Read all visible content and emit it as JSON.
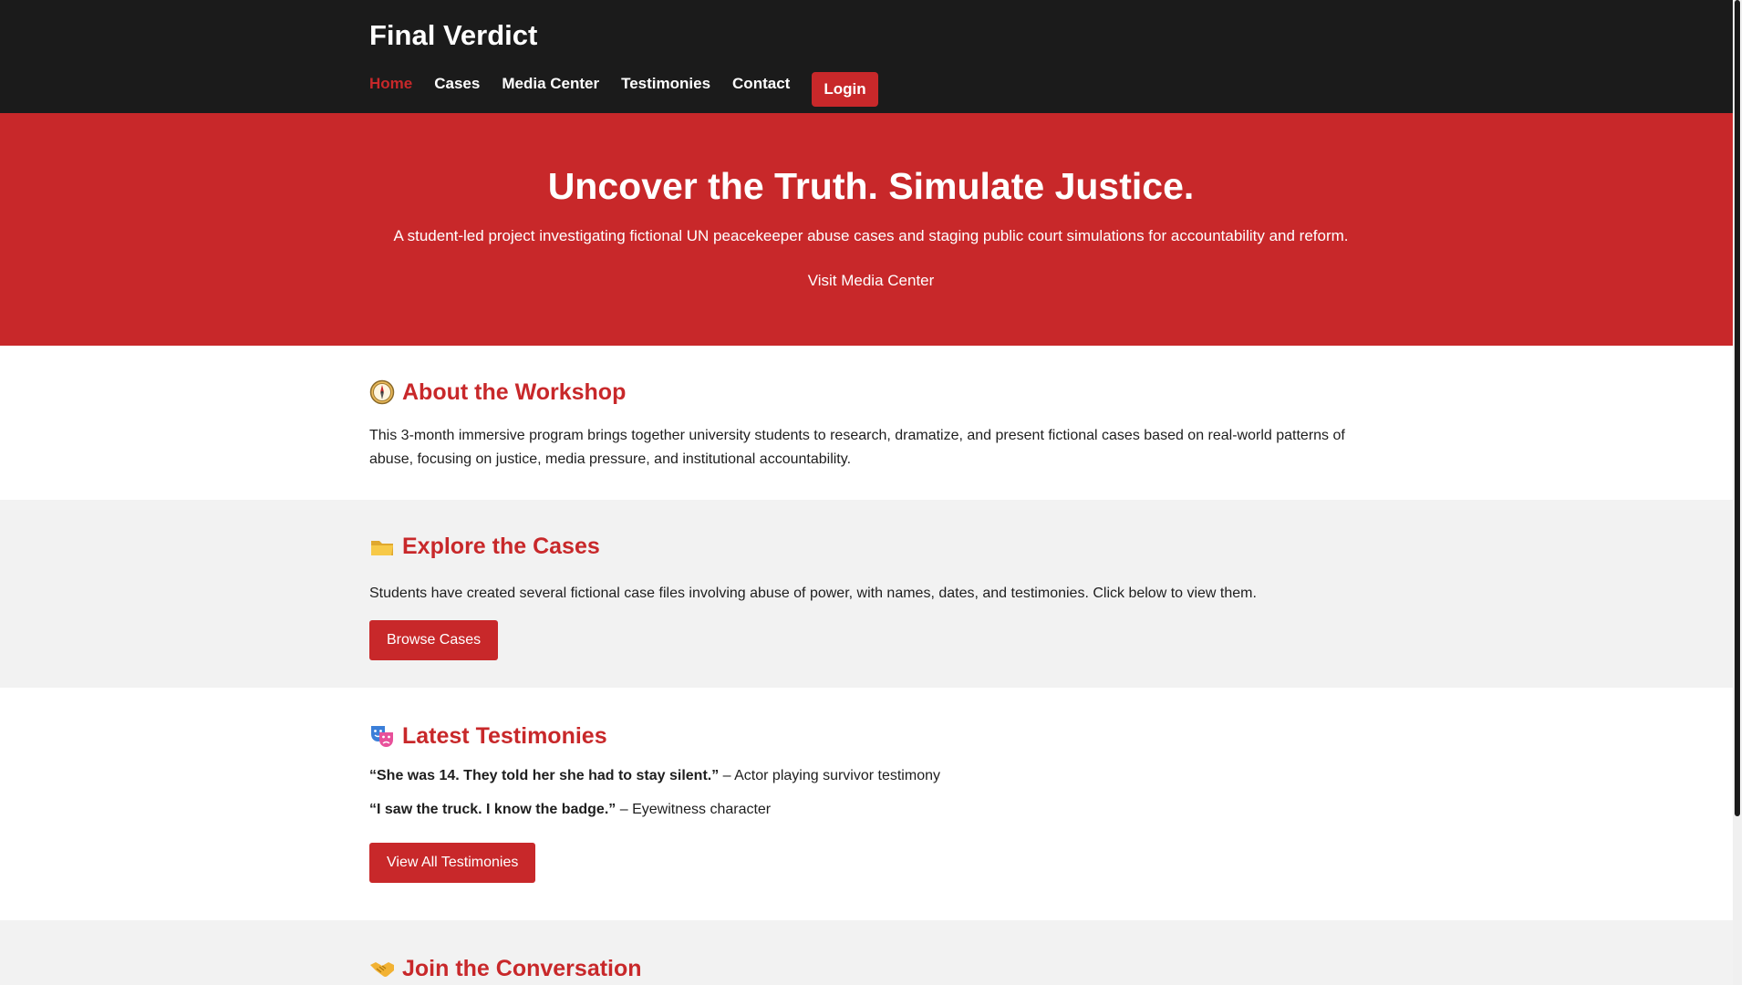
{
  "header": {
    "site_title": "Final Verdict",
    "nav": [
      {
        "label": "Home",
        "active": true
      },
      {
        "label": "Cases",
        "active": false
      },
      {
        "label": "Media Center",
        "active": false
      },
      {
        "label": "Testimonies",
        "active": false
      },
      {
        "label": "Contact",
        "active": false
      }
    ],
    "login_label": "Login"
  },
  "hero": {
    "title": "Uncover the Truth. Simulate Justice.",
    "subtitle": "A student-led project investigating fictional UN peacekeeper abuse cases and staging public court simulations for accountability and reform.",
    "cta_label": "Visit Media Center"
  },
  "about": {
    "icon": "compass-icon",
    "title": "About the Workshop",
    "text": "This 3-month immersive program brings together university students to research, dramatize, and present fictional cases based on real-world patterns of abuse, focusing on justice, media pressure, and institutional accountability."
  },
  "cases": {
    "icon": "folder-icon",
    "title": "Explore the Cases",
    "text": "Students have created several fictional case files involving abuse of power, with names, dates, and testimonies. Click below to view them.",
    "button_label": "Browse Cases"
  },
  "testimonies": {
    "icon": "theater-masks-icon",
    "title": "Latest Testimonies",
    "quotes": [
      {
        "quote": "“She was 14. They told her she had to stay silent.”",
        "attribution": " – Actor playing survivor testimony"
      },
      {
        "quote": "“I saw the truck. I know the badge.”",
        "attribution": " – Eyewitness character"
      }
    ],
    "button_label": "View All Testimonies"
  },
  "join": {
    "icon": "handshake-icon",
    "title": "Join the Conversation"
  },
  "colors": {
    "brand_red": "#c8282a",
    "header_bg": "#1b1b1b",
    "section_gray": "#f2f2f2"
  }
}
